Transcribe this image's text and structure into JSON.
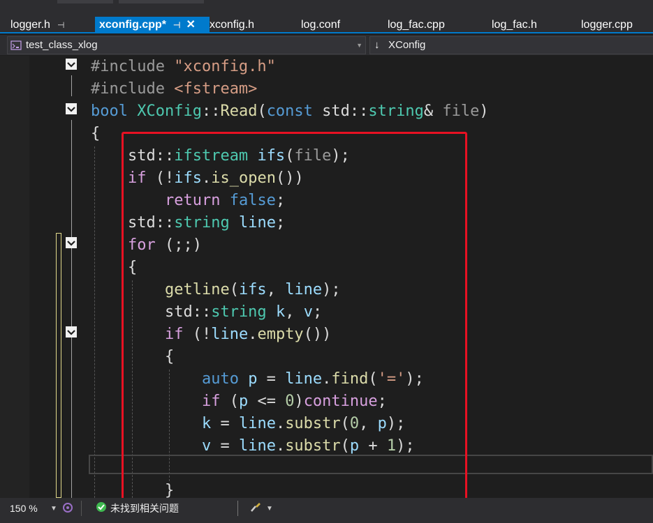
{
  "tabs": [
    {
      "label": "logger.h",
      "pinned": true
    },
    {
      "label": "xconfig.cpp*",
      "pinned": true,
      "active": true
    },
    {
      "label": "xconfig.h"
    },
    {
      "label": "log.conf"
    },
    {
      "label": "log_fac.cpp"
    },
    {
      "label": "log_fac.h"
    },
    {
      "label": "logger.cpp"
    }
  ],
  "icons": {
    "pin": "pin-icon",
    "close": "close-icon",
    "project": "project-icon",
    "member": "member-icon",
    "fold": "fold-toggle-icon",
    "ok": "check-circle-icon",
    "brush": "brush-icon",
    "copilot": "ai-assistant-icon"
  },
  "nav": {
    "project": "test_class_xlog",
    "member_arrow": "↓",
    "member": "XConfig"
  },
  "code": [
    {
      "indent": "",
      "tokens": [
        {
          "t": "#include ",
          "c": "pp"
        },
        {
          "t": "\"xconfig.h\"",
          "c": "str"
        }
      ]
    },
    {
      "indent": "",
      "tokens": [
        {
          "t": "#include ",
          "c": "pp"
        },
        {
          "t": "<fstream>",
          "c": "str"
        }
      ]
    },
    {
      "indent": "",
      "tokens": [
        {
          "t": "bool",
          "c": "kw"
        },
        {
          "t": " "
        },
        {
          "t": "XConfig",
          "c": "type"
        },
        {
          "t": "::"
        },
        {
          "t": "Read",
          "c": "fn"
        },
        {
          "t": "("
        },
        {
          "t": "const",
          "c": "kw"
        },
        {
          "t": " std::"
        },
        {
          "t": "string",
          "c": "type"
        },
        {
          "t": "& "
        },
        {
          "t": "file",
          "c": "param"
        },
        {
          "t": ")"
        }
      ]
    },
    {
      "indent": "",
      "tokens": [
        {
          "t": "{"
        }
      ]
    },
    {
      "indent": "    ",
      "tokens": [
        {
          "t": "std::"
        },
        {
          "t": "ifstream",
          "c": "type"
        },
        {
          "t": " "
        },
        {
          "t": "ifs",
          "c": "var"
        },
        {
          "t": "("
        },
        {
          "t": "file",
          "c": "param"
        },
        {
          "t": ");"
        }
      ]
    },
    {
      "indent": "    ",
      "tokens": [
        {
          "t": "if",
          "c": "ctl"
        },
        {
          "t": " (!"
        },
        {
          "t": "ifs",
          "c": "var"
        },
        {
          "t": "."
        },
        {
          "t": "is_open",
          "c": "fn"
        },
        {
          "t": "())"
        }
      ]
    },
    {
      "indent": "        ",
      "tokens": [
        {
          "t": "return",
          "c": "ctl"
        },
        {
          "t": " "
        },
        {
          "t": "false",
          "c": "kw"
        },
        {
          "t": ";"
        }
      ]
    },
    {
      "indent": "    ",
      "tokens": [
        {
          "t": "std::"
        },
        {
          "t": "string",
          "c": "type"
        },
        {
          "t": " "
        },
        {
          "t": "line",
          "c": "var"
        },
        {
          "t": ";"
        }
      ]
    },
    {
      "indent": "    ",
      "tokens": [
        {
          "t": "for",
          "c": "ctl"
        },
        {
          "t": " (;;)"
        }
      ]
    },
    {
      "indent": "    ",
      "tokens": [
        {
          "t": "{"
        }
      ]
    },
    {
      "indent": "        ",
      "tokens": [
        {
          "t": "getline",
          "c": "fn"
        },
        {
          "t": "("
        },
        {
          "t": "ifs",
          "c": "var"
        },
        {
          "t": ", "
        },
        {
          "t": "line",
          "c": "var"
        },
        {
          "t": ");"
        }
      ]
    },
    {
      "indent": "        ",
      "tokens": [
        {
          "t": "std::"
        },
        {
          "t": "string",
          "c": "type"
        },
        {
          "t": " "
        },
        {
          "t": "k",
          "c": "var"
        },
        {
          "t": ", "
        },
        {
          "t": "v",
          "c": "var"
        },
        {
          "t": ";"
        }
      ]
    },
    {
      "indent": "        ",
      "tokens": [
        {
          "t": "if",
          "c": "ctl"
        },
        {
          "t": " (!"
        },
        {
          "t": "line",
          "c": "var"
        },
        {
          "t": "."
        },
        {
          "t": "empty",
          "c": "fn"
        },
        {
          "t": "())"
        }
      ]
    },
    {
      "indent": "        ",
      "tokens": [
        {
          "t": "{"
        }
      ]
    },
    {
      "indent": "            ",
      "tokens": [
        {
          "t": "auto",
          "c": "kw"
        },
        {
          "t": " "
        },
        {
          "t": "p",
          "c": "var"
        },
        {
          "t": " = "
        },
        {
          "t": "line",
          "c": "var"
        },
        {
          "t": "."
        },
        {
          "t": "find",
          "c": "fn"
        },
        {
          "t": "("
        },
        {
          "t": "'='",
          "c": "str"
        },
        {
          "t": ");"
        }
      ]
    },
    {
      "indent": "            ",
      "tokens": [
        {
          "t": "if",
          "c": "ctl"
        },
        {
          "t": " ("
        },
        {
          "t": "p",
          "c": "var"
        },
        {
          "t": " <= "
        },
        {
          "t": "0",
          "c": "num"
        },
        {
          "t": ")"
        },
        {
          "t": "continue",
          "c": "ctl"
        },
        {
          "t": ";"
        }
      ]
    },
    {
      "indent": "            ",
      "tokens": [
        {
          "t": "k",
          "c": "var"
        },
        {
          "t": " = "
        },
        {
          "t": "line",
          "c": "var"
        },
        {
          "t": "."
        },
        {
          "t": "substr",
          "c": "fn"
        },
        {
          "t": "("
        },
        {
          "t": "0",
          "c": "num"
        },
        {
          "t": ", "
        },
        {
          "t": "p",
          "c": "var"
        },
        {
          "t": ");"
        }
      ]
    },
    {
      "indent": "            ",
      "tokens": [
        {
          "t": "v",
          "c": "var"
        },
        {
          "t": " = "
        },
        {
          "t": "line",
          "c": "var"
        },
        {
          "t": "."
        },
        {
          "t": "substr",
          "c": "fn"
        },
        {
          "t": "("
        },
        {
          "t": "p",
          "c": "var"
        },
        {
          "t": " + "
        },
        {
          "t": "1",
          "c": "num"
        },
        {
          "t": ");"
        }
      ]
    },
    {
      "indent": "",
      "tokens": []
    },
    {
      "indent": "        ",
      "tokens": [
        {
          "t": "}"
        }
      ]
    }
  ],
  "status": {
    "zoom": "150 %",
    "issues": "未找到相关问题"
  }
}
